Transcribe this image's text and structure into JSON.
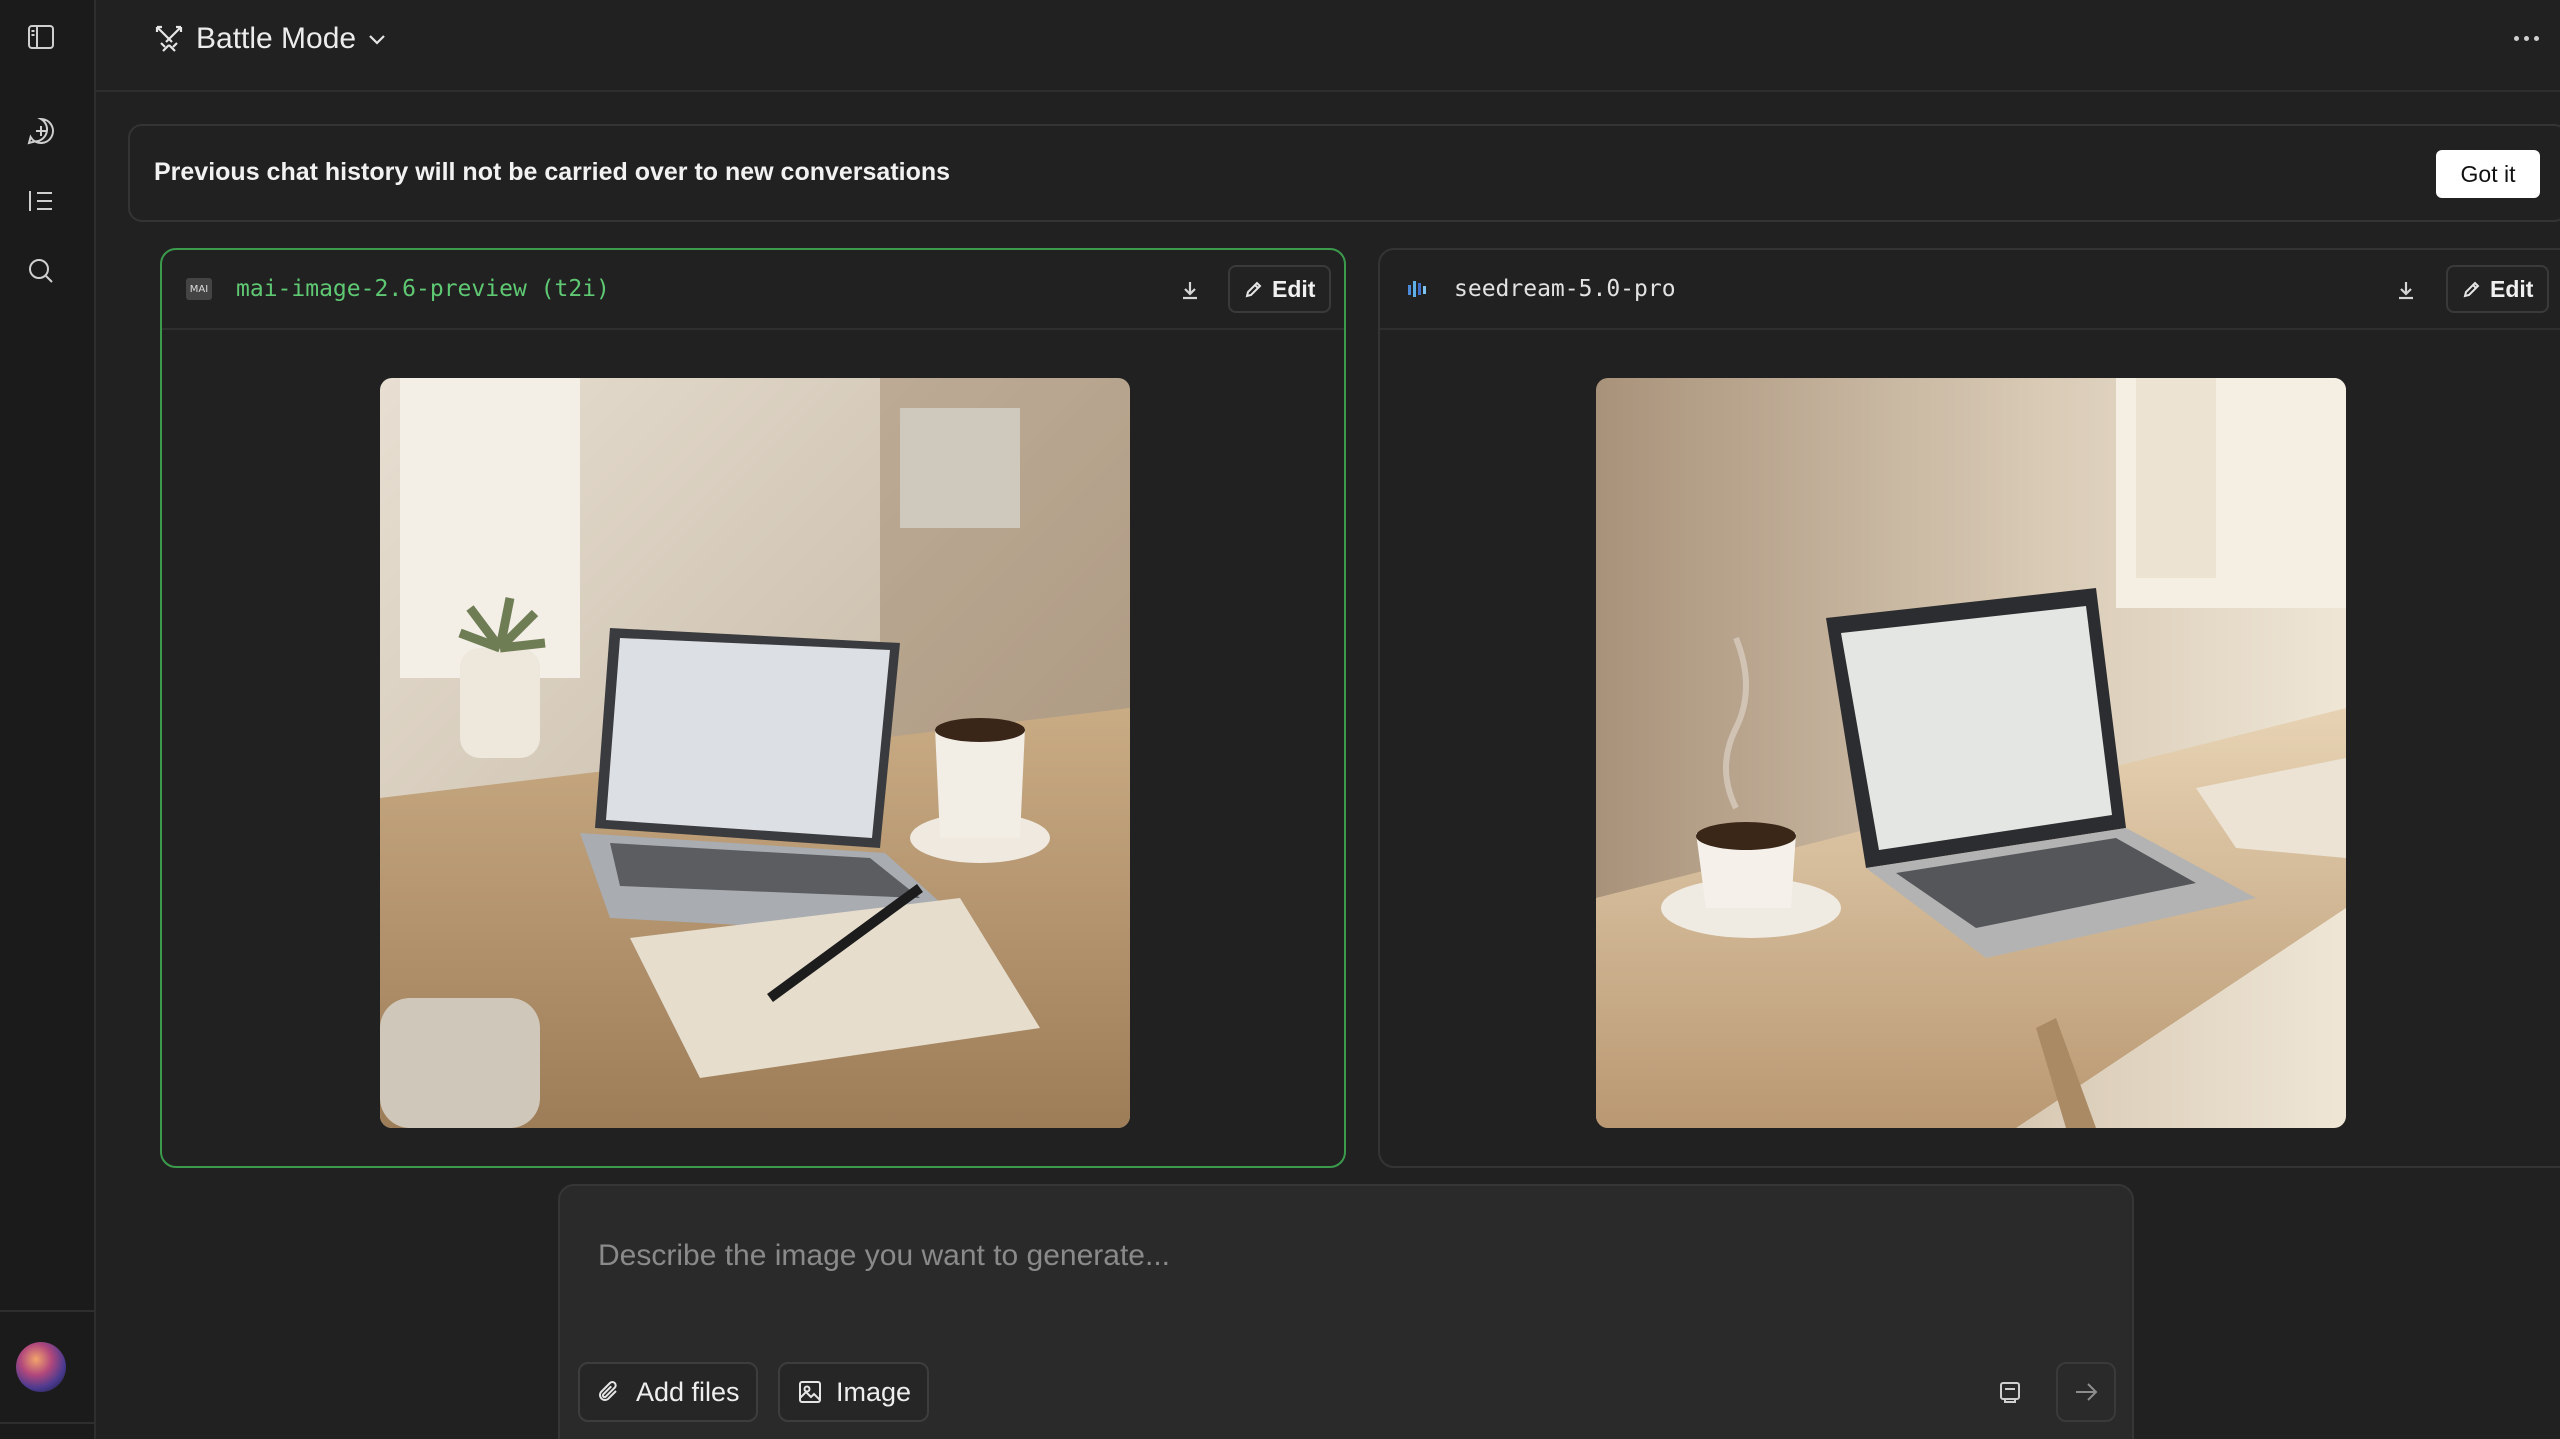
{
  "header": {
    "mode_label": "Battle Mode",
    "mode_icon": "crossed-swords-icon"
  },
  "sidebar": {
    "items": [
      {
        "icon": "sidebar-toggle-icon"
      },
      {
        "icon": "new-chat-icon"
      },
      {
        "icon": "list-icon"
      },
      {
        "icon": "search-icon"
      }
    ]
  },
  "notice": {
    "text": "Previous chat history will not be carried over to new conversations",
    "button_label": "Got it"
  },
  "panels": [
    {
      "model_logo": "MAI",
      "model_name": "mai-image-2.6-preview (t2i)",
      "edit_label": "Edit",
      "selected": true,
      "accent": "#3c9a4c"
    },
    {
      "model_name": "seedream-5.0-pro",
      "edit_label": "Edit",
      "selected": false
    }
  ],
  "prompt": {
    "placeholder": "Describe the image you want to generate...",
    "add_files_label": "Add files",
    "image_label": "Image"
  }
}
